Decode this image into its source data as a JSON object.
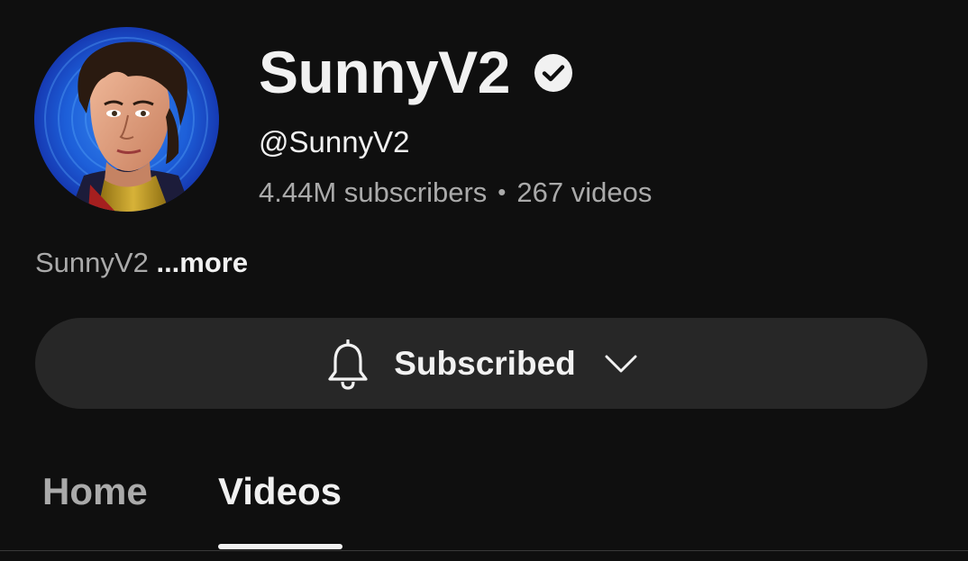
{
  "channel": {
    "name": "SunnyV2",
    "handle": "@SunnyV2",
    "subscribers": "4.44M subscribers",
    "separator": "•",
    "videos": "267 videos",
    "description": "SunnyV2",
    "more_label": "...more",
    "verified_icon": "verified-check-icon",
    "avatar": "channel-avatar-portrait"
  },
  "subscribe": {
    "label": "Subscribed",
    "icon": "bell-icon",
    "dropdown_icon": "chevron-down-icon"
  },
  "tabs": [
    {
      "label": "Home",
      "active": false
    },
    {
      "label": "Videos",
      "active": true
    }
  ],
  "colors": {
    "background": "#0f0f0f",
    "text_primary": "#f1f1f1",
    "text_secondary": "#aaaaaa",
    "button_bg": "#272727",
    "avatar_ring": "#1e4fd6"
  }
}
